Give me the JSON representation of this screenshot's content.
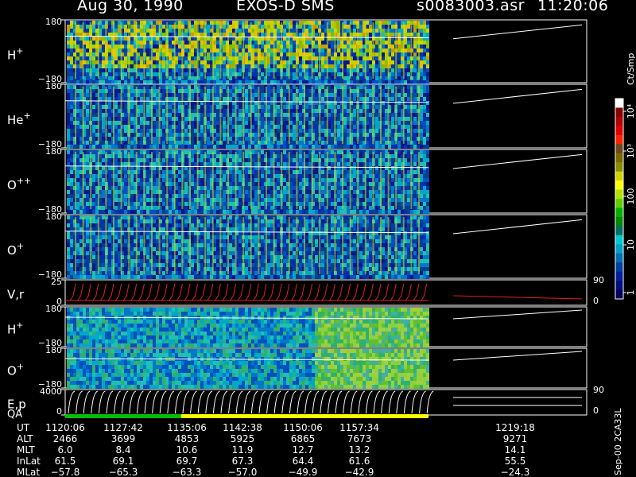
{
  "header": {
    "date": "Aug 30, 1990",
    "mission": "EXOS-D SMS",
    "file": "s0083003.asr",
    "time": "11:20:06"
  },
  "chart_data": {
    "type": "heatmap",
    "panels": [
      {
        "label": "H",
        "superscript": "+",
        "ytop": "180",
        "ybottom": "−180"
      },
      {
        "label": "He",
        "superscript": "+",
        "ytop": "180",
        "ybottom": "−180"
      },
      {
        "label": "O",
        "superscript": "++",
        "ytop": "180",
        "ybottom": "−180"
      },
      {
        "label": "O",
        "superscript": "+",
        "ytop": "180",
        "ybottom": "−180"
      },
      {
        "label": "V,r",
        "superscript": "",
        "ytop": "25",
        "ybottom": "0",
        "rtop": "90",
        "rbottom": "0"
      },
      {
        "label": "H",
        "superscript": "+",
        "ytop": "180",
        "ybottom": "−180"
      },
      {
        "label": "O",
        "superscript": "+",
        "ytop": "180",
        "ybottom": "−180"
      },
      {
        "label": "E,p",
        "superscript": "",
        "ytop": "4000",
        "ybottom": "0",
        "rtop": "90",
        "rbottom": "0"
      }
    ],
    "qa_label": "QA",
    "qa_colors": [
      "#00c000",
      "#ffff00"
    ],
    "colorbar": {
      "unit": "Ct/Smp",
      "labels": [
        "10⁴",
        "10³",
        "100",
        "10",
        "1"
      ],
      "colors": [
        "#ffffff",
        "#8b0000",
        "#b00000",
        "#e00000",
        "#ff2000",
        "#6b4a1a",
        "#7a6a00",
        "#8c8c00",
        "#d0d000",
        "#ffff00",
        "#b0e000",
        "#60d000",
        "#00b000",
        "#008800",
        "#007060",
        "#00c8d0",
        "#00a0c8",
        "#0070b0",
        "#0040a0",
        "#0020a0",
        "#001080",
        "#000060"
      ]
    },
    "ephemeris": {
      "row_labels": [
        "UT",
        "ALT",
        "MLT",
        "InLat",
        "MLat"
      ],
      "columns": [
        [
          "1120:06",
          "2466",
          "6.0",
          "61.5",
          "−57.8"
        ],
        [
          "1127:42",
          "3699",
          "8.4",
          "69.1",
          "−65.3"
        ],
        [
          "1135:06",
          "4853",
          "10.6",
          "69.7",
          "−63.3"
        ],
        [
          "1142:38",
          "5925",
          "11.9",
          "67.3",
          "−57.0"
        ],
        [
          "1150:06",
          "6865",
          "12.7",
          "64.4",
          "−49.9"
        ],
        [
          "1157:34",
          "7673",
          "13.2",
          "61.6",
          "−42.9"
        ],
        [
          "1219:18",
          "9271",
          "14.1",
          "55.5",
          "−24.3"
        ]
      ]
    },
    "footer_code": "Sep-00 2CA33L"
  }
}
